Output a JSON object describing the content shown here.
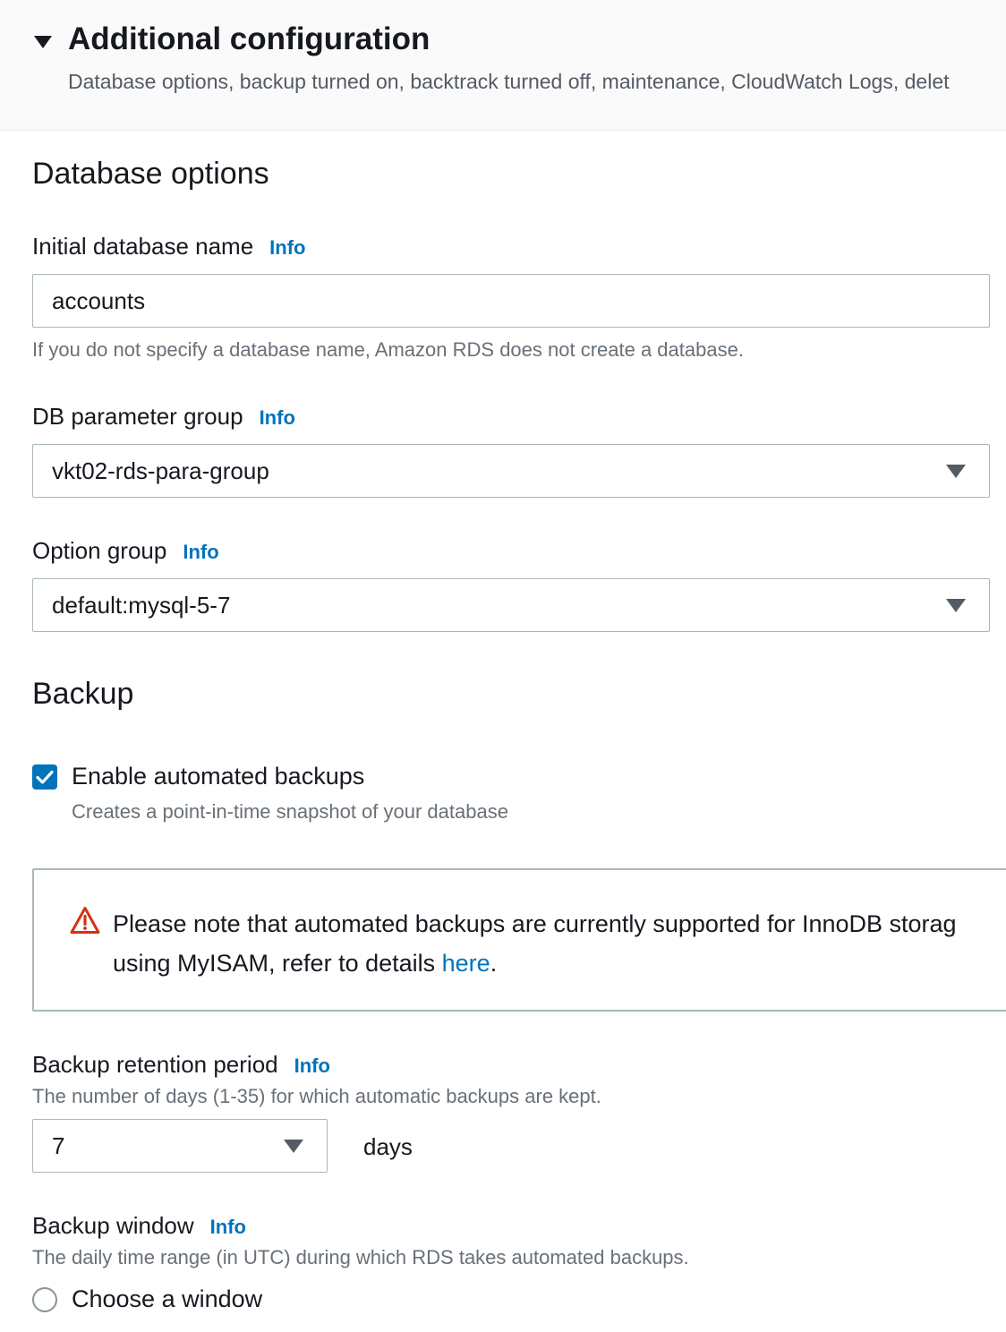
{
  "additional_config": {
    "title": "Additional configuration",
    "description": "Database options, backup turned on, backtrack turned off, maintenance, CloudWatch Logs, delet"
  },
  "database_options": {
    "heading": "Database options",
    "initial_db_name": {
      "label": "Initial database name",
      "info": "Info",
      "value": "accounts",
      "hint": "If you do not specify a database name, Amazon RDS does not create a database."
    },
    "db_parameter_group": {
      "label": "DB parameter group",
      "info": "Info",
      "value": "vkt02-rds-para-group"
    },
    "option_group": {
      "label": "Option group",
      "info": "Info",
      "value": "default:mysql-5-7"
    }
  },
  "backup": {
    "heading": "Backup",
    "enable_automated": {
      "label": "Enable automated backups",
      "description": "Creates a point-in-time snapshot of your database",
      "checked": true
    },
    "alert": {
      "line1": "Please note that automated backups are currently supported for InnoDB storag",
      "line2_prefix": "using MyISAM, refer to details ",
      "link": "here",
      "line2_suffix": "."
    },
    "retention": {
      "label": "Backup retention period",
      "info": "Info",
      "hint": "The number of days (1-35) for which automatic backups are kept.",
      "value": "7",
      "unit": "days"
    },
    "window": {
      "label": "Backup window",
      "info": "Info",
      "hint": "The daily time range (in UTC) during which RDS takes automated backups.",
      "option": "Choose a window"
    }
  },
  "colors": {
    "link": "#0073bb",
    "checkbox": "#0073bb",
    "warning": "#d13212",
    "border": "#aab7b8"
  },
  "icons": [
    "caret-down-icon",
    "dropdown-arrow-icon",
    "checkmark-icon",
    "warning-icon"
  ]
}
